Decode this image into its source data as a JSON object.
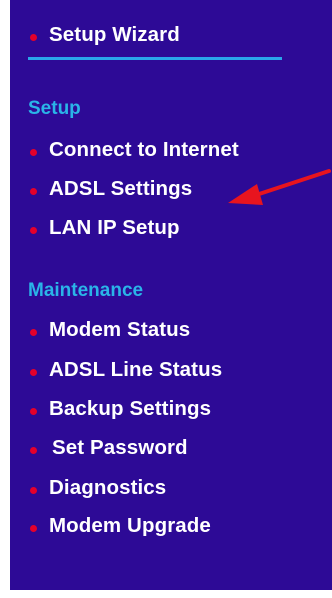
{
  "menu": {
    "top": {
      "label": "Setup Wizard"
    },
    "sections": [
      {
        "heading": "Setup",
        "items": [
          {
            "label": "Connect to Internet"
          },
          {
            "label": "ADSL Settings"
          },
          {
            "label": "LAN IP Setup"
          }
        ]
      },
      {
        "heading": "Maintenance",
        "items": [
          {
            "label": "Modem Status"
          },
          {
            "label": "ADSL Line Status"
          },
          {
            "label": "Backup Settings"
          },
          {
            "label": "Set Password"
          },
          {
            "label": "Diagnostics"
          },
          {
            "label": "Modem Upgrade"
          }
        ]
      }
    ]
  },
  "annotation": {
    "icon": "red-arrow-icon",
    "color": "#e8141e"
  },
  "colors": {
    "sidebar_bg": "#2d0a96",
    "bullet": "#e4002b",
    "heading": "#2ab4e8",
    "text": "#ffffff"
  }
}
